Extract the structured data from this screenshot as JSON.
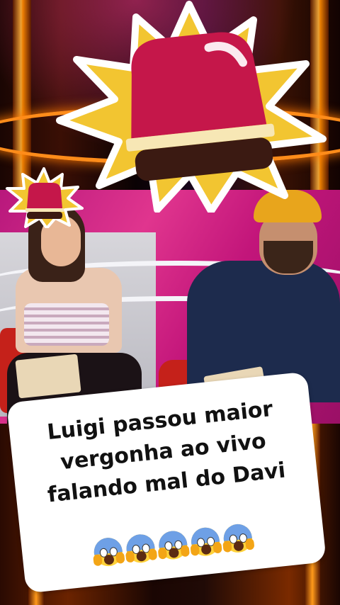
{
  "caption": {
    "lines": [
      "Luigi passou maior",
      "vergonha ao vivo",
      "falando mal do Davi"
    ],
    "emoji": "face-screaming-in-fear",
    "emoji_count": 5
  },
  "sticker": {
    "icon": "siren-icon",
    "colors": {
      "star": "#f2c531",
      "dome": "#c5174a",
      "band": "#f7e7b5",
      "base": "#3b1a12"
    }
  }
}
